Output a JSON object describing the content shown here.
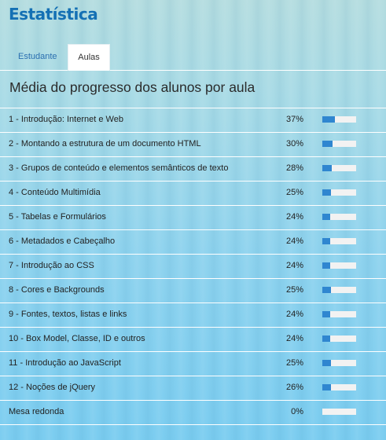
{
  "header": {
    "title": "Estatística"
  },
  "tabs": [
    {
      "label": "Estudante",
      "active": false
    },
    {
      "label": "Aulas",
      "active": true
    }
  ],
  "main": {
    "section_title": "Média do progresso dos alunos por aula",
    "rows": [
      {
        "name": "1 - Introdução: Internet e Web",
        "percent_text": "37%",
        "progress": 37
      },
      {
        "name": "2 - Montando a estrutura de um documento HTML",
        "percent_text": "30%",
        "progress": 30
      },
      {
        "name": "3 - Grupos de conteúdo e elementos semânticos de texto",
        "percent_text": "28%",
        "progress": 28
      },
      {
        "name": "4 - Conteúdo Multimídia",
        "percent_text": "25%",
        "progress": 25
      },
      {
        "name": "5 - Tabelas e Formulários",
        "percent_text": "24%",
        "progress": 24
      },
      {
        "name": "6 - Metadados e Cabeçalho",
        "percent_text": "24%",
        "progress": 24
      },
      {
        "name": "7 - Introdução ao CSS",
        "percent_text": "24%",
        "progress": 24
      },
      {
        "name": "8 - Cores e Backgrounds",
        "percent_text": "25%",
        "progress": 25
      },
      {
        "name": "9 - Fontes, textos, listas e links",
        "percent_text": "24%",
        "progress": 24
      },
      {
        "name": "10 - Box Model, Classe, ID e outros",
        "percent_text": "24%",
        "progress": 24
      },
      {
        "name": "11 - Introdução ao JavaScript",
        "percent_text": "25%",
        "progress": 25
      },
      {
        "name": "12 - Noções de jQuery",
        "percent_text": "26%",
        "progress": 26
      },
      {
        "name": "Mesa redonda",
        "percent_text": "0%",
        "progress": 0
      }
    ]
  },
  "colors": {
    "title": "#1470b4",
    "tab_link": "#2a6fb0",
    "bar_fill": "#2f86d0",
    "bar_track": "#f2f2f2"
  }
}
